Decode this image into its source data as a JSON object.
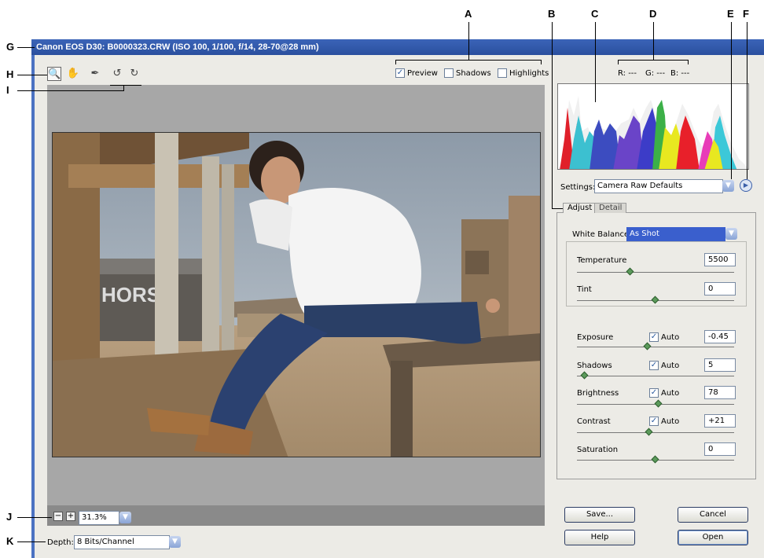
{
  "window": {
    "title": "Canon EOS D30:  B0000323.CRW  (ISO 100, 1/100, f/14, 28-70@28 mm)"
  },
  "callouts": {
    "a": "A",
    "b": "B",
    "c": "C",
    "d": "D",
    "e": "E",
    "f": "F",
    "g": "G",
    "h": "H",
    "i": "I",
    "j": "J",
    "k": "K"
  },
  "toolbar": {
    "tools": [
      {
        "icon": "zoom-icon",
        "selected": true
      },
      {
        "icon": "hand-icon",
        "selected": false
      },
      {
        "icon": "eyedropper-icon",
        "selected": false
      },
      {
        "icon": "rotate-left-icon",
        "selected": false
      },
      {
        "icon": "rotate-right-icon",
        "selected": false
      }
    ],
    "preview_label": "Preview",
    "preview_checked": true,
    "shadows_label": "Shadows",
    "shadows_checked": false,
    "highlights_label": "Highlights",
    "highlights_checked": false
  },
  "readout": {
    "r": "R: ---",
    "g": "G: ---",
    "b": "B: ---"
  },
  "settings": {
    "label": "Settings:",
    "value": "Camera Raw Defaults",
    "menu_icon": "flyout-menu-icon"
  },
  "tabs": {
    "adjust": "Adjust",
    "detail": "Detail"
  },
  "white_balance": {
    "label": "White Balance:",
    "value": "As Shot"
  },
  "controls": {
    "temperature": {
      "label": "Temperature",
      "value": "5500",
      "level": 0.34
    },
    "tint": {
      "label": "Tint",
      "value": "0",
      "level": 0.5
    },
    "exposure": {
      "label": "Exposure",
      "value": "-0.45",
      "auto_label": "Auto",
      "auto": true,
      "level": 0.45
    },
    "shadows": {
      "label": "Shadows",
      "value": "5",
      "auto_label": "Auto",
      "auto": true,
      "level": 0.05
    },
    "brightness": {
      "label": "Brightness",
      "value": "78",
      "auto_label": "Auto",
      "auto": true,
      "level": 0.52
    },
    "contrast": {
      "label": "Contrast",
      "value": "+21",
      "auto_label": "Auto",
      "auto": true,
      "level": 0.46
    },
    "saturation": {
      "label": "Saturation",
      "value": "0",
      "level": 0.5
    }
  },
  "zoom": {
    "minus": "−",
    "plus": "+",
    "value": "31.3%"
  },
  "depth": {
    "label": "Depth:",
    "value": "8 Bits/Channel"
  },
  "buttons": {
    "save": "Save...",
    "cancel": "Cancel",
    "help": "Help",
    "open": "Open"
  },
  "photo": {
    "sign_text": "HORS"
  },
  "colors": {
    "titlebar": "#2a4f9e",
    "accent": "#3b64b8",
    "checkmark": "#2a5a9e",
    "slider_thumb": "#5b9a5b"
  }
}
